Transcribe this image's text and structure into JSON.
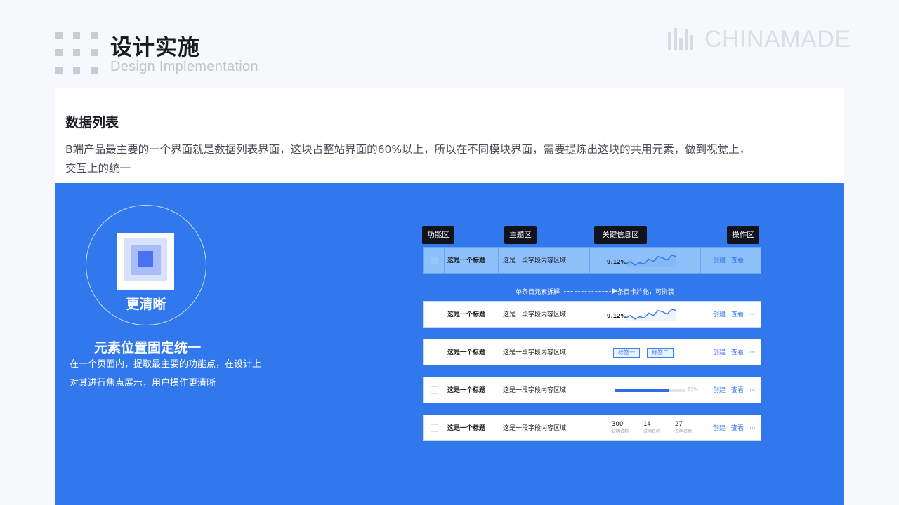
{
  "header": {
    "title": "设计实施",
    "subtitle": "Design Implementation",
    "brand": "CHINAMADE"
  },
  "intro": {
    "heading": "数据列表",
    "description": "B端产品最主要的一个界面就是数据列表界面，这块占整站界面的60%以上，所以在不同模块界面，需要提炼出这块的共用元素，做到视觉上，交互上的统一"
  },
  "feature": {
    "badge_label": "更清晰",
    "title": "元素位置固定统一",
    "description": "在一个页面内，提取最主要的功能点，在设计上对其进行焦点展示，用户操作更清晰"
  },
  "zones": [
    "功能区",
    "主题区",
    "关键信息区",
    "操作区"
  ],
  "split_label": "单条目元素拆解",
  "card_label": "条目卡片化，可拼装",
  "colors": {
    "panel": "#3178ec",
    "accent": "#2f73e8",
    "highlight_row": "#8dbff8"
  },
  "rows": [
    {
      "title": "这是一个标题",
      "content": "这是一段字段内容区域",
      "key_type": "sparkline",
      "percent": "9.12%",
      "sparkline": [
        3,
        4,
        2.5,
        3.5,
        3,
        5,
        4,
        6,
        5.5,
        4.5,
        6.5,
        6
      ],
      "actions": [
        "创建",
        "查看"
      ],
      "more": ""
    },
    {
      "title": "这是一个标题",
      "content": "这是一段字段内容区域",
      "key_type": "sparkline",
      "percent": "9.12%",
      "sparkline": [
        3,
        4,
        2.5,
        3.5,
        3,
        5,
        4,
        6,
        5.5,
        4.5,
        6.5,
        6
      ],
      "actions": [
        "创建",
        "查看"
      ],
      "more": "···"
    },
    {
      "title": "这是一个标题",
      "content": "这是一段字段内容区域",
      "key_type": "tags",
      "tags": [
        "标签一",
        "标签二"
      ],
      "actions": [
        "创建",
        "查看"
      ],
      "more": "···"
    },
    {
      "title": "这是一个标题",
      "content": "这是一段字段内容区域",
      "key_type": "progress",
      "progress": 0.78,
      "progress_label": "69%",
      "actions": [
        "创建",
        "查看"
      ],
      "more": "···"
    },
    {
      "title": "这是一个标题",
      "content": "这是一段字段内容区域",
      "key_type": "stats",
      "stats": [
        {
          "value": "300",
          "label": "说明名称一"
        },
        {
          "value": "14",
          "label": "说明名称一"
        },
        {
          "value": "27",
          "label": "说明名称一"
        }
      ],
      "actions": [
        "创建",
        "查看"
      ],
      "more": "···"
    }
  ]
}
